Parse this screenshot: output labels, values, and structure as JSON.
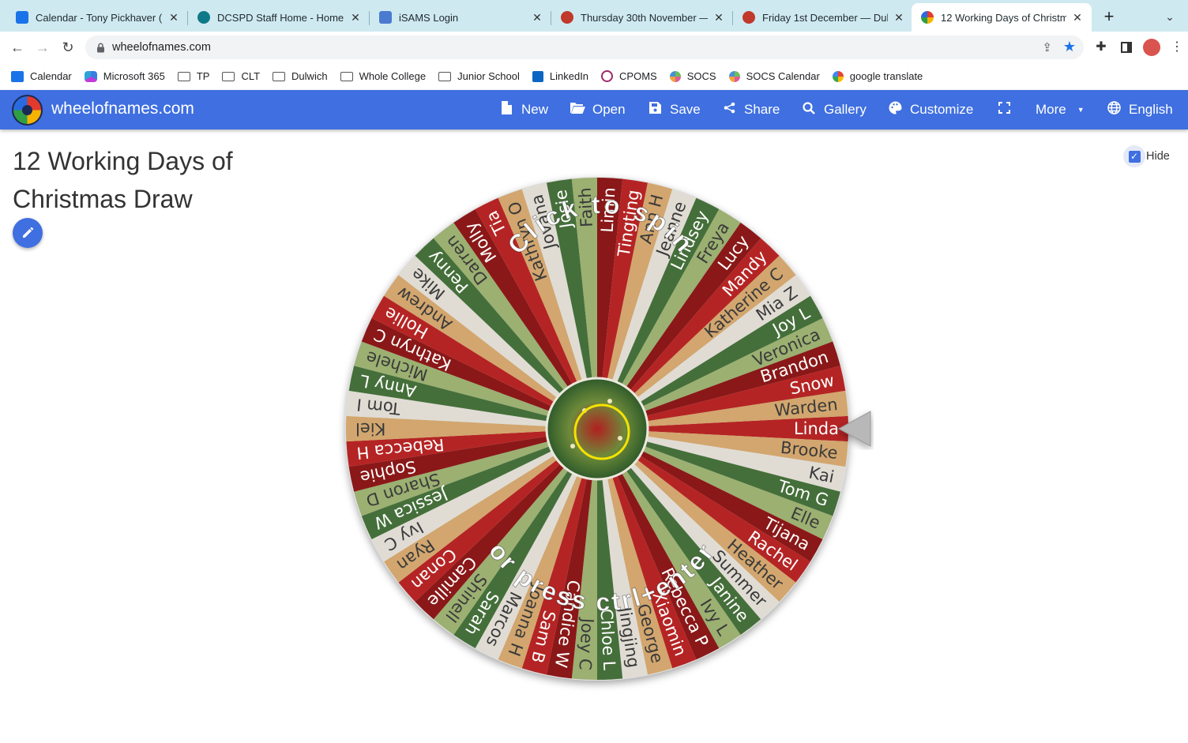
{
  "tabs": [
    {
      "label": "Calendar - Tony Pickhaver (",
      "color": "#1a73e8"
    },
    {
      "label": "DCSPD Staff Home - Home",
      "color": "#0f7a87"
    },
    {
      "label": "iSAMS Login",
      "color": "#4a7bd0"
    },
    {
      "label": "Thursday 30th November —",
      "color": "#c0392b"
    },
    {
      "label": "Friday 1st December — Dulw",
      "color": "#c0392b"
    },
    {
      "label": "12 Working Days of Christm",
      "color": "#e8710a"
    }
  ],
  "url": "wheelofnames.com",
  "bookmarks": [
    {
      "label": "Calendar",
      "icon": "calendar-icon"
    },
    {
      "label": "Microsoft 365",
      "icon": "m365-icon"
    },
    {
      "label": "TP",
      "icon": "folder-icon"
    },
    {
      "label": "CLT",
      "icon": "folder-icon"
    },
    {
      "label": "Dulwich",
      "icon": "folder-icon"
    },
    {
      "label": "Whole College",
      "icon": "folder-icon"
    },
    {
      "label": "Junior School",
      "icon": "folder-icon"
    },
    {
      "label": "LinkedIn",
      "icon": "linkedin-icon"
    },
    {
      "label": "CPOMS",
      "icon": "cpoms-icon"
    },
    {
      "label": "SOCS",
      "icon": "socs-icon"
    },
    {
      "label": "SOCS Calendar",
      "icon": "socs-icon"
    },
    {
      "label": "google translate",
      "icon": "google-icon"
    }
  ],
  "app": {
    "title": "wheelofnames.com",
    "menu": [
      {
        "label": "New",
        "icon": "file-icon"
      },
      {
        "label": "Open",
        "icon": "folder-open-icon"
      },
      {
        "label": "Save",
        "icon": "save-icon"
      },
      {
        "label": "Share",
        "icon": "share-icon"
      },
      {
        "label": "Gallery",
        "icon": "search-icon"
      },
      {
        "label": "Customize",
        "icon": "palette-icon"
      },
      {
        "label": "",
        "icon": "fullscreen-icon"
      },
      {
        "label": "More",
        "icon": "chevron-down-icon"
      },
      {
        "label": "English",
        "icon": "globe-icon"
      }
    ],
    "accent": "#3f6fe0"
  },
  "page": {
    "wheel_title": "12 Working Days of Christmas Draw",
    "hide_label": "Hide",
    "hide_checked": true
  },
  "wheel": {
    "top_text": "Click to spin",
    "bottom_text": "or press ctrl+enter",
    "colors": [
      "#b52424",
      "#d2a66e",
      "#e0dcd4",
      "#456f3a",
      "#9bb071",
      "#8a1818"
    ],
    "names": [
      "Linda",
      "Brooke",
      "Kai",
      "Tom G",
      "Elle",
      "Tijana",
      "Rachel",
      "Heather",
      "Summer",
      "Janine",
      "Ivy L",
      "Rebecca P",
      "Xiaomin",
      "George",
      "Jingjing",
      "Chloe L",
      "Joey C",
      "Candice W",
      "Sam B",
      "Joanna H",
      "Marcos",
      "Sarah",
      "Shinell",
      "Camille",
      "Conan",
      "Ryan",
      "Ivy C",
      "Jessica W",
      "Sharon D",
      "Sophie",
      "Rebecca H",
      "Kiel",
      "Tom I",
      "Anny L",
      "Michele",
      "Kathryn C",
      "Hollie",
      "Andrew",
      "Mike",
      "Penny",
      "Darren",
      "Molly",
      "Tia",
      "Kathryn O",
      "Jovana",
      "Josie",
      "Faith",
      "Limin",
      "Tingting",
      "Ann H",
      "Jeanne",
      "Lindsey",
      "Freya",
      "Lucy",
      "Mandy",
      "Katherine C",
      "Mia Z",
      "Joy L",
      "Veronica",
      "Brandon",
      "Snow",
      "Warden"
    ]
  }
}
